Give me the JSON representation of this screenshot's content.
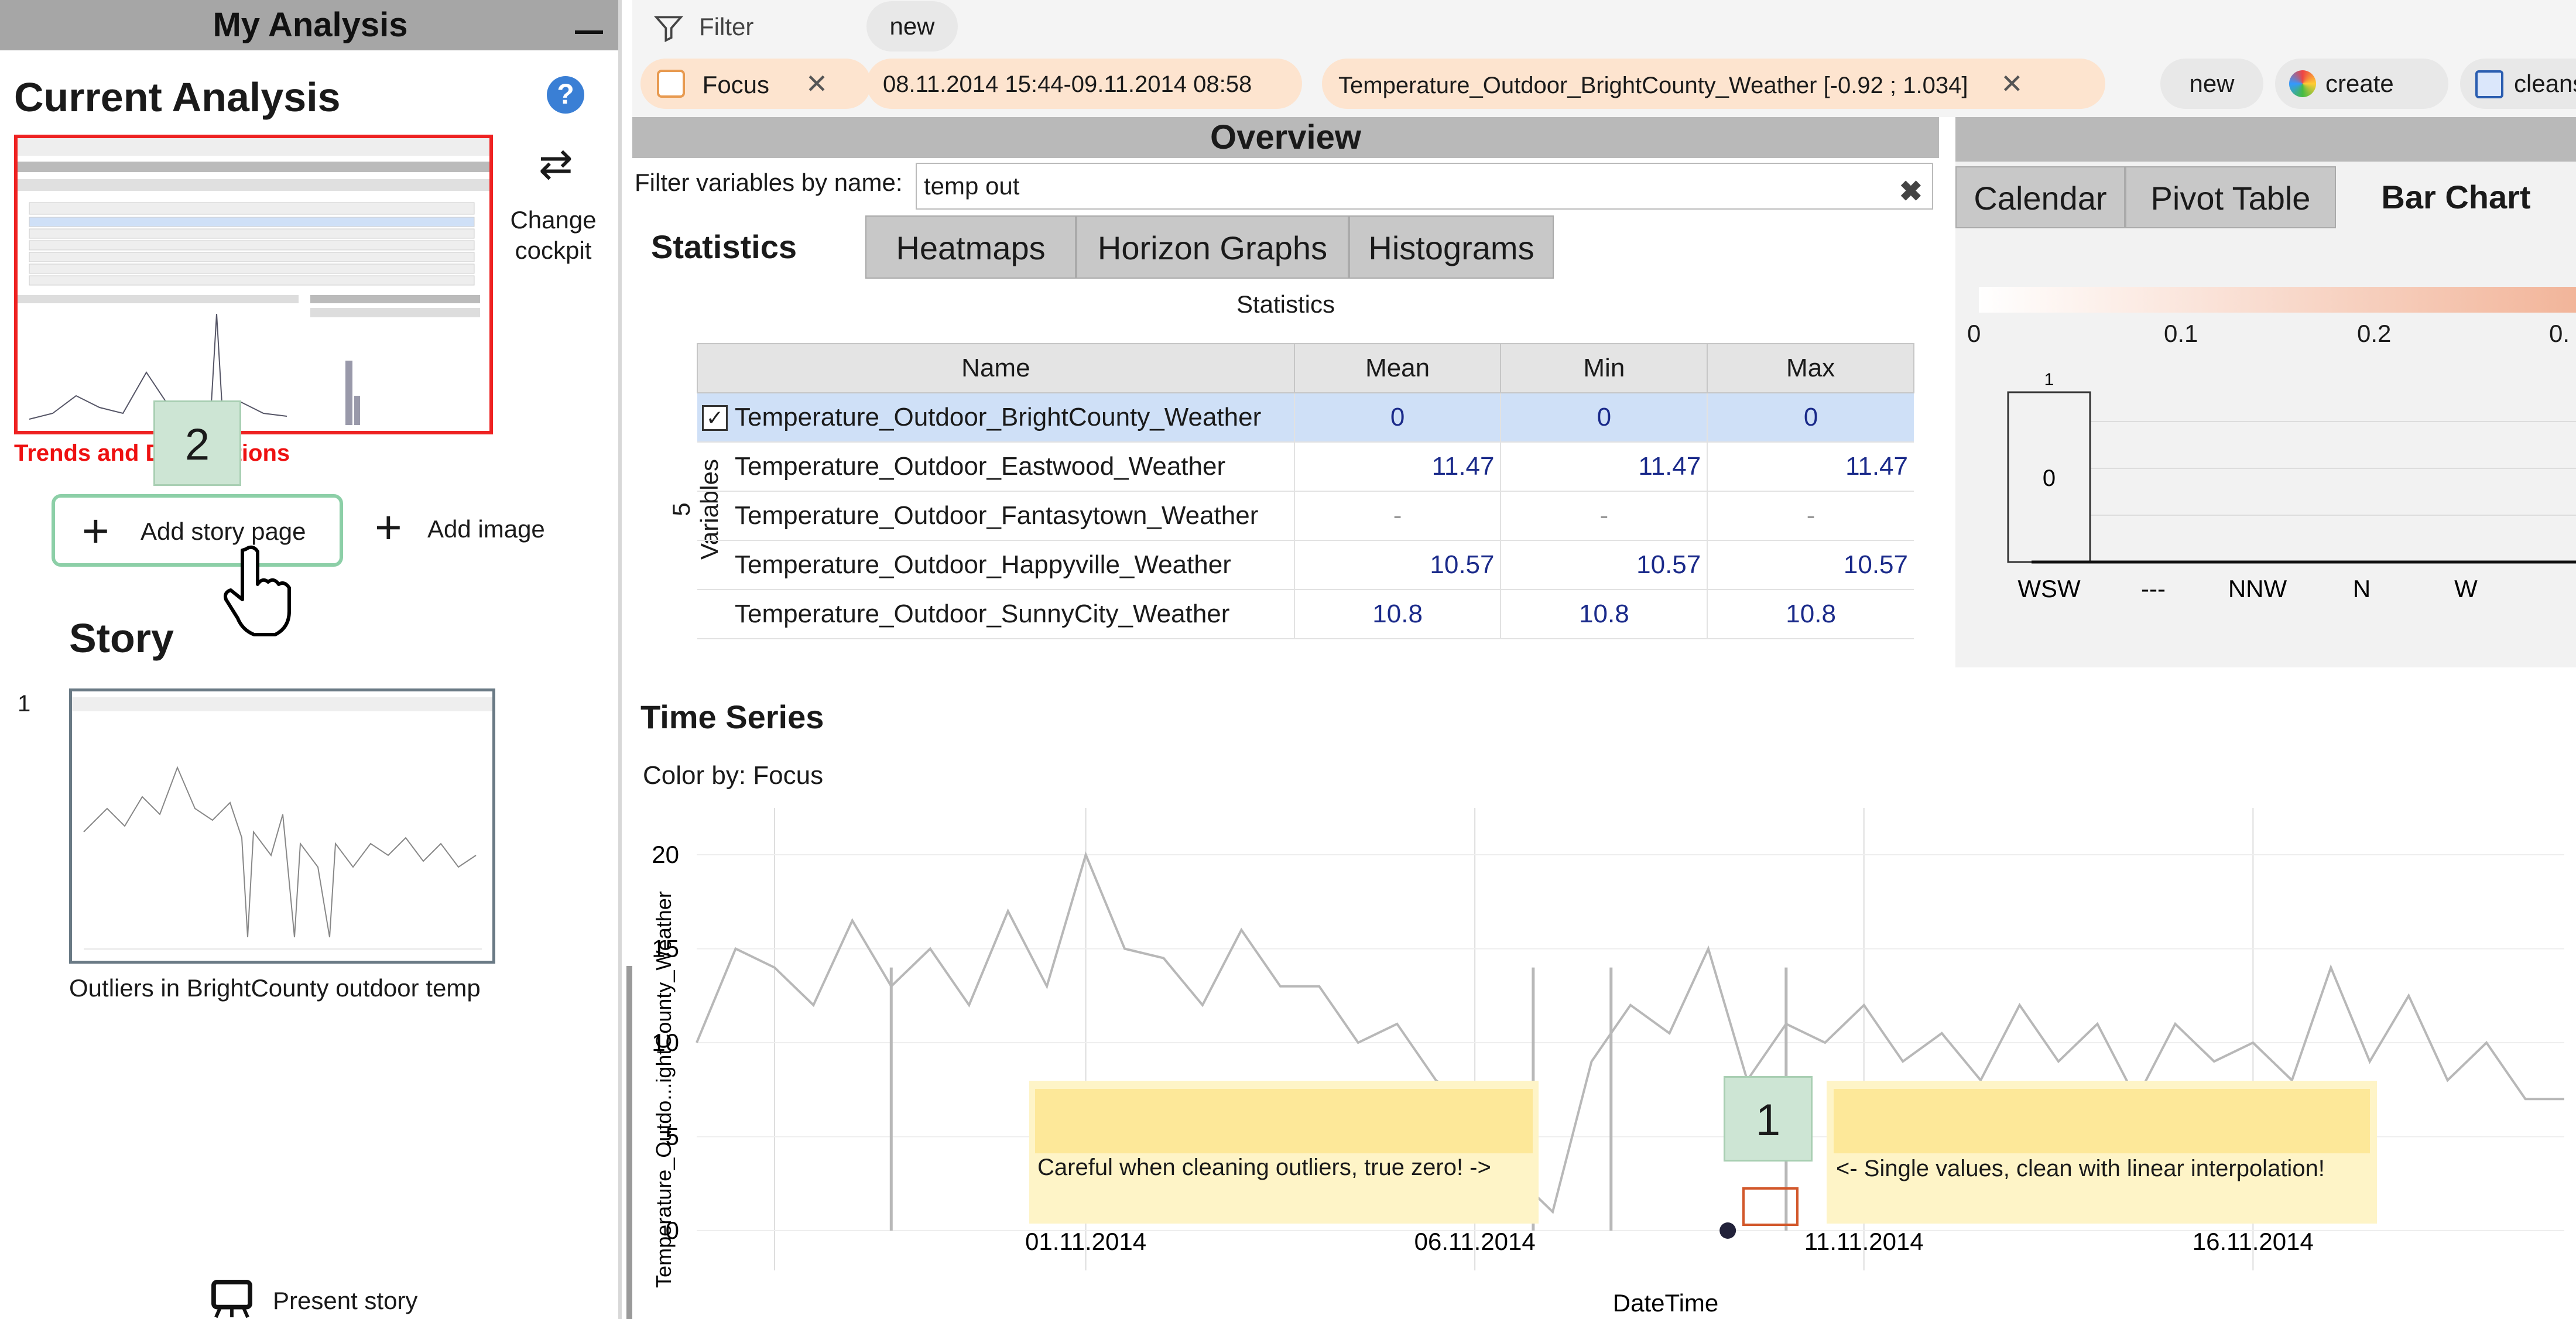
{
  "left_panel": {
    "header": "My Analysis",
    "current_analysis_title": "Current Analysis",
    "change_cockpit_label": "Change cockpit",
    "current_thumbnail_caption": "Trends and Distributions",
    "step_badge": "2",
    "add_story_page_label": "Add story page",
    "add_image_label": "Add image",
    "story_title": "Story",
    "story_items": [
      {
        "number": "1",
        "caption": "Outliers in BrightCounty outdoor temp"
      }
    ],
    "present_story_label": "Present story"
  },
  "filter_bar": {
    "filter_label": "Filter",
    "new_chip": "new",
    "focus_chip": "Focus",
    "date_chip": "08.11.2014 15:44-09.11.2014 08:58",
    "range_chip": "Temperature_Outdoor_BrightCounty_Weather [-0.92 ; 1.034]",
    "new_button": "new",
    "create_button": "create",
    "cleanse_button": "cleanse"
  },
  "overview": {
    "title": "Overview",
    "filter_label": "Filter variables by name:",
    "filter_value": "temp out",
    "tabs": [
      "Statistics",
      "Heatmaps",
      "Horizon Graphs",
      "Histograms"
    ],
    "active_tab": "Statistics",
    "table_caption": "Statistics",
    "variable_count_label": "5 Variables",
    "columns": [
      "Name",
      "Mean",
      "Min",
      "Max"
    ],
    "rows": [
      {
        "name": "Temperature_Outdoor_BrightCounty_Weather",
        "mean": "0",
        "min": "0",
        "max": "0",
        "selected": true
      },
      {
        "name": "Temperature_Outdoor_Eastwood_Weather",
        "mean": "11.47",
        "min": "11.47",
        "max": "11.47"
      },
      {
        "name": "Temperature_Outdoor_Fantasytown_Weather",
        "mean": "-",
        "min": "-",
        "max": "-"
      },
      {
        "name": "Temperature_Outdoor_Happyville_Weather",
        "mean": "10.57",
        "min": "10.57",
        "max": "10.57"
      },
      {
        "name": "Temperature_Outdoor_SunnyCity_Weather",
        "mean": "10.8",
        "min": "10.8",
        "max": "10.8"
      }
    ]
  },
  "right_panel": {
    "tabs": [
      "Calendar",
      "Pivot Table",
      "Bar Chart"
    ],
    "active_tab": "Bar Chart",
    "color_scale_ticks": [
      "0",
      "0.1",
      "0.2",
      "0."
    ],
    "bar_chart": {
      "type": "bar",
      "categories": [
        "WSW",
        "---",
        "NNW",
        "N",
        "W"
      ],
      "values": [
        1,
        0,
        0,
        0,
        0
      ],
      "bar_top_label": "1",
      "bar_inner_label": "0"
    }
  },
  "time_series": {
    "title": "Time Series",
    "color_by": "Color by: Focus",
    "step_badge": "1",
    "annotation_left": "Careful when cleaning outliers, true zero! ->",
    "annotation_right": "<- Single values, clean with linear interpolation!",
    "chart_data": {
      "type": "line",
      "xlabel": "DateTime",
      "ylabel": "Temperature_Outdo...ightCounty_Weather",
      "x_ticks": [
        "01.11.2014",
        "06.11.2014",
        "11.11.2014",
        "16.11.2014"
      ],
      "y_ticks": [
        "0",
        "5",
        "10",
        "15",
        "20"
      ],
      "ylim": [
        -1,
        21
      ],
      "xlim": [
        "2014-10-27",
        "2014-11-20"
      ],
      "series": [
        {
          "x": [
            "2014-10-27 00:00",
            "2014-10-27 12:00",
            "2014-10-28 00:00",
            "2014-10-28 12:00",
            "2014-10-29 00:00",
            "2014-10-29 12:00",
            "2014-10-30 00:00",
            "2014-10-30 12:00",
            "2014-10-31 00:00",
            "2014-10-31 12:00",
            "2014-11-01 00:00",
            "2014-11-01 12:00",
            "2014-11-02 00:00",
            "2014-11-02 12:00",
            "2014-11-03 00:00",
            "2014-11-03 12:00",
            "2014-11-04 00:00",
            "2014-11-04 12:00",
            "2014-11-05 00:00",
            "2014-11-05 12:00",
            "2014-11-06 00:00",
            "2014-11-06 12:00",
            "2014-11-07 00:00",
            "2014-11-07 12:00",
            "2014-11-08 00:00",
            "2014-11-08 12:00",
            "2014-11-09 00:00",
            "2014-11-09 12:00",
            "2014-11-10 00:00",
            "2014-11-10 12:00",
            "2014-11-11 00:00",
            "2014-11-11 12:00",
            "2014-11-12 00:00",
            "2014-11-12 12:00",
            "2014-11-13 00:00",
            "2014-11-13 12:00",
            "2014-11-14 00:00",
            "2014-11-14 12:00",
            "2014-11-15 00:00",
            "2014-11-15 12:00",
            "2014-11-16 00:00",
            "2014-11-16 12:00",
            "2014-11-17 00:00",
            "2014-11-17 12:00",
            "2014-11-18 00:00",
            "2014-11-18 12:00",
            "2014-11-19 00:00",
            "2014-11-19 12:00",
            "2014-11-20 00:00"
          ],
          "y": [
            10,
            15,
            14,
            12,
            16.5,
            13,
            15,
            12,
            17,
            13,
            20,
            15,
            14.5,
            12,
            16,
            13,
            13,
            10,
            11,
            8,
            6.5,
            3,
            1,
            9,
            12,
            10.5,
            15,
            8,
            11,
            10,
            12,
            9,
            10.5,
            8,
            12,
            9,
            11,
            7,
            11,
            9,
            10,
            8,
            14,
            9,
            12.5,
            8,
            10,
            7,
            7
          ]
        }
      ],
      "focus_point": {
        "x": "2014-11-09 06:00",
        "y": 0
      }
    }
  },
  "colors": {
    "accent_blue": "#3a7fd5",
    "chip_bg": "#fde4cf",
    "badge_green": "#cde5d4",
    "annotation_yellow": "#fef4c7",
    "highlight_red": "#e22222"
  }
}
